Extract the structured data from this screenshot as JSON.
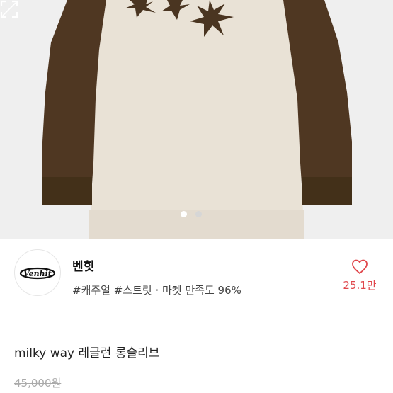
{
  "product_image": {
    "alt_icon": "star-graphic",
    "carousel": {
      "total": 2,
      "active": 1
    },
    "expand_icon": "expand-icon"
  },
  "shop": {
    "logo_text": "Venhit",
    "name": "벤힛",
    "tags": "#캐주얼 #스트릿 · 마켓 만족도 96%",
    "like_count": "25.1만",
    "heart_icon": "heart-icon",
    "accent_color": "#e0474c"
  },
  "product": {
    "title": "milky way 레글런 롱슬리브",
    "price": "45,000원"
  }
}
